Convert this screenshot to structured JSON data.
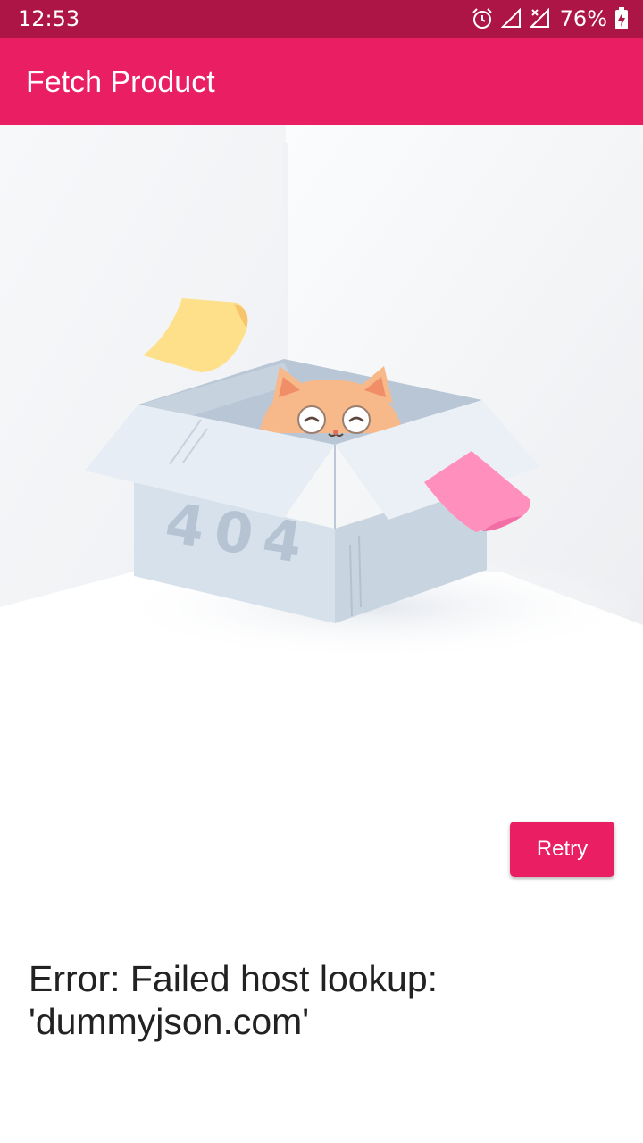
{
  "status_bar": {
    "time": "12:53",
    "battery_percent": "76%",
    "icons": [
      "alarm-icon",
      "signal-icon",
      "no-signal-icon",
      "battery-charging-icon"
    ]
  },
  "app_bar": {
    "title": "Fetch Product"
  },
  "illustration": {
    "box_label": "404"
  },
  "retry_button": {
    "label": "Retry"
  },
  "error": {
    "message": "Error: Failed host lookup: 'dummyjson.com'"
  },
  "colors": {
    "primary": "#e91e63",
    "status_bar": "#ad1547",
    "text": "#222222"
  }
}
